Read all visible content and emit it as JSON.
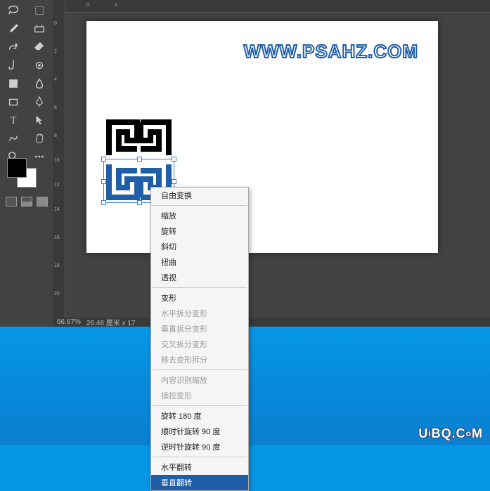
{
  "toolbox": {
    "tools": [
      "lasso-tool",
      "crop-tool",
      "brush-tool",
      "content-aware-tool",
      "spot-heal-tool",
      "eraser-tool",
      "gradient-tool",
      "paint-bucket-region-tool",
      "clone-stamp-tool",
      "blur-tool",
      "rectangle-tool",
      "pen-tool",
      "type-tool",
      "path-select-tool",
      "shape-tool",
      "hand-tool",
      "zoom-tool",
      "more-tool"
    ],
    "colors": {
      "foreground": "#000000",
      "background": "#ffffff"
    }
  },
  "rulers": {
    "unit": "厘米",
    "vertical_ticks": [
      "0",
      "2",
      "4",
      "6",
      "8",
      "10",
      "12",
      "14",
      "16",
      "18",
      "20"
    ],
    "horizontal_ticks": [
      "0",
      "2"
    ]
  },
  "canvas": {
    "watermark": "WWW.PSAHZ.COM",
    "selection": {
      "visible": true
    }
  },
  "context_menu": {
    "groups": [
      [
        {
          "label": "自由变换",
          "key": "free_transform"
        }
      ],
      [
        {
          "label": "缩放",
          "key": "scale"
        },
        {
          "label": "旋转",
          "key": "rotate"
        },
        {
          "label": "斜切",
          "key": "skew"
        },
        {
          "label": "扭曲",
          "key": "distort"
        },
        {
          "label": "透视",
          "key": "perspective"
        }
      ],
      [
        {
          "label": "变形",
          "key": "warp"
        },
        {
          "label": "水平拆分变形",
          "key": "split_warp_h",
          "disabled": true
        },
        {
          "label": "垂直拆分变形",
          "key": "split_warp_v",
          "disabled": true
        },
        {
          "label": "交叉拆分变形",
          "key": "split_warp_cross",
          "disabled": true
        },
        {
          "label": "移去变形拆分",
          "key": "remove_warp_split",
          "disabled": true
        }
      ],
      [
        {
          "label": "内容识别缩放",
          "key": "content_aware_scale",
          "disabled": true
        },
        {
          "label": "操控变形",
          "key": "puppet_warp",
          "disabled": true
        }
      ],
      [
        {
          "label": "旋转 180 度",
          "key": "rotate180"
        },
        {
          "label": "顺时针旋转 90 度",
          "key": "rotate90cw"
        },
        {
          "label": "逆时针旋转 90 度",
          "key": "rotate90ccw"
        }
      ],
      [
        {
          "label": "水平翻转",
          "key": "flip_h"
        },
        {
          "label": "垂直翻转",
          "key": "flip_v",
          "highlighted": true
        }
      ]
    ]
  },
  "status_bar": {
    "zoom": "66.67%",
    "doc_info": "26.46 厘米 x 17"
  },
  "desktop_watermark": {
    "text": "UiBQ.CoM"
  }
}
